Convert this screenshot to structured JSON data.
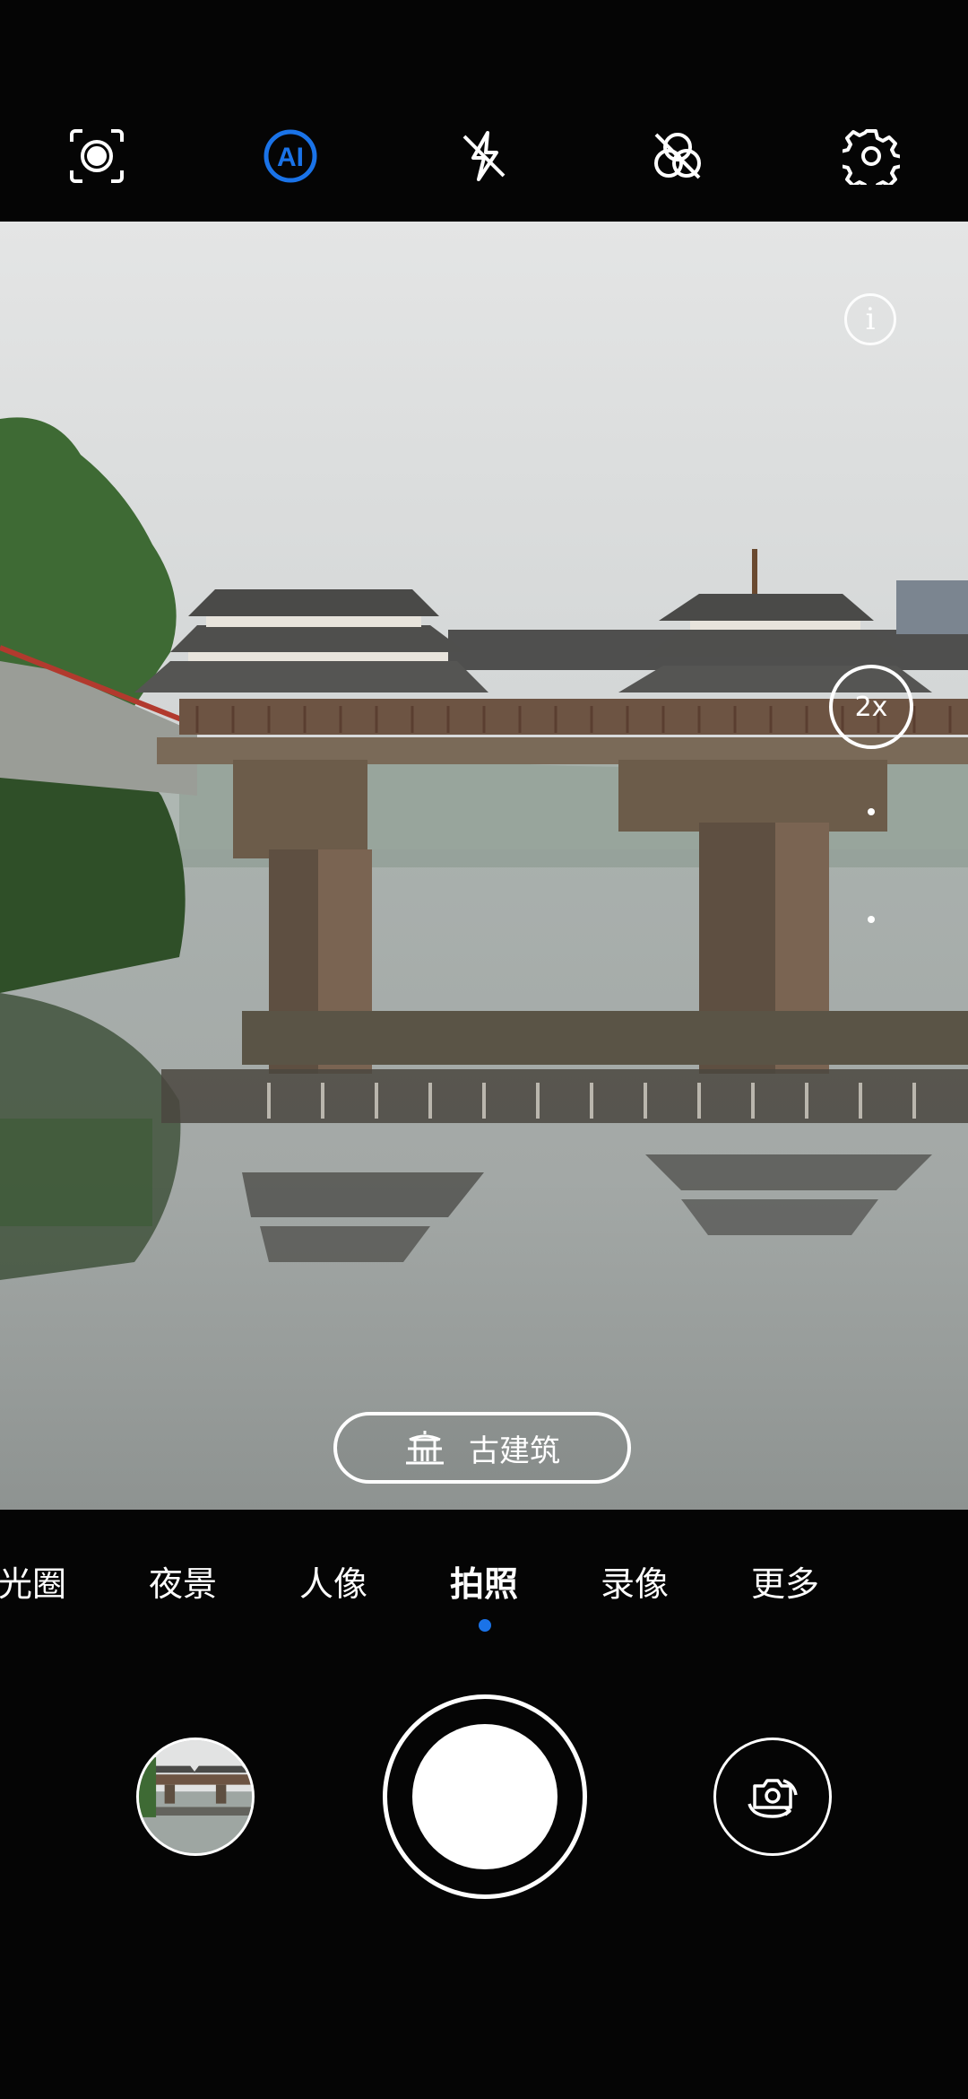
{
  "top_bar": {
    "icons": [
      "mirror-selfie-icon",
      "ai-icon",
      "flash-off-icon",
      "filter-off-icon",
      "settings-gear-icon"
    ],
    "ai_label": "AI",
    "ai_color": "#1a73e8"
  },
  "viewfinder": {
    "info_label": "i",
    "zoom_label": "2x",
    "scene_tag": {
      "icon": "ancient-building-icon",
      "label": "古建筑"
    }
  },
  "modes": {
    "items": [
      "光圈",
      "夜景",
      "人像",
      "拍照",
      "录像",
      "更多"
    ],
    "active": "拍照",
    "active_color": "#1a73e8"
  },
  "controls": {
    "gallery_thumbnail": "gallery-thumbnail",
    "shutter": "shutter-button",
    "switch_camera": "switch-camera-icon"
  }
}
